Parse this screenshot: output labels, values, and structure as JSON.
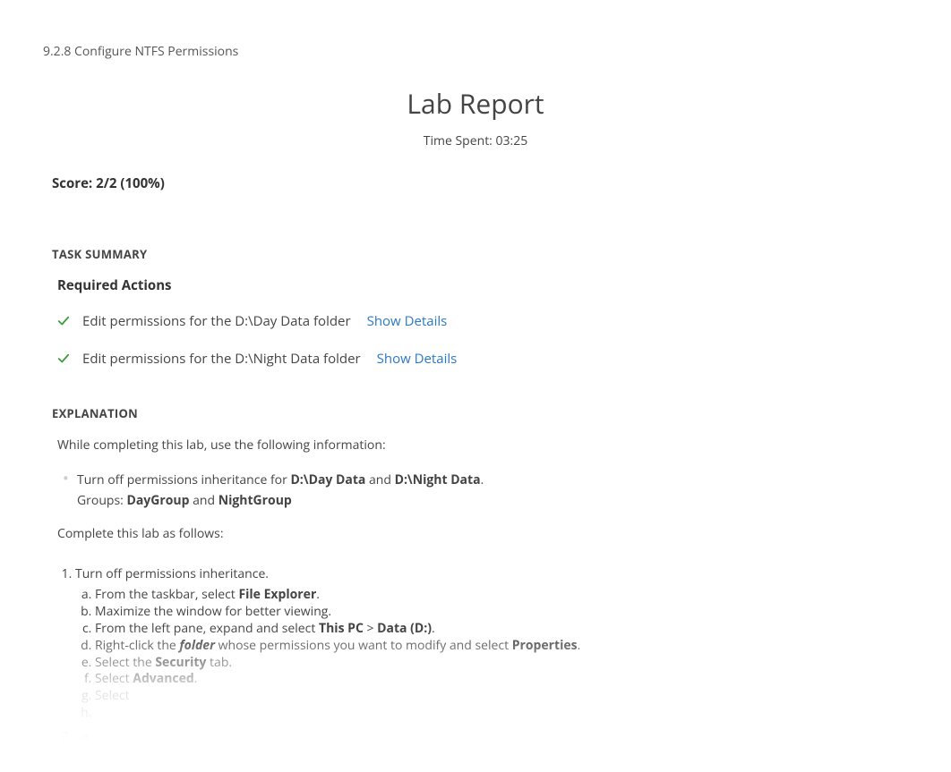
{
  "breadcrumb": "9.2.8 Configure NTFS Permissions",
  "report": {
    "title": "Lab Report",
    "time_label": "Time Spent:",
    "time_value": "03:25",
    "score_label": "Score:",
    "score_value": "2/2 (100%)"
  },
  "task_summary": {
    "heading": "TASK SUMMARY",
    "required_heading": "Required Actions",
    "actions": [
      {
        "text": "Edit permissions for the D:\\Day Data folder",
        "details_label": "Show Details"
      },
      {
        "text": "Edit permissions for the D:\\Night Data folder",
        "details_label": "Show Details"
      }
    ]
  },
  "explanation": {
    "heading": "EXPLANATION",
    "intro": "While completing this lab, use the following information:",
    "bullet": {
      "line1_pre": "Turn off permissions inheritance for ",
      "line1_b1": "D:\\Day Data",
      "line1_mid": " and ",
      "line1_b2": "D:\\Night Data",
      "line1_post": ".",
      "line2_pre": "Groups: ",
      "line2_b1": "DayGroup",
      "line2_mid": " and ",
      "line2_b2": "NightGroup"
    },
    "complete": "Complete this lab as follows:",
    "steps": {
      "s1": "Turn off permissions inheritance.",
      "s1a_pre": "From the taskbar, select ",
      "s1a_b": "File Explorer",
      "s1a_post": ".",
      "s1b": "Maximize the window for better viewing.",
      "s1c_pre": "From the left pane, expand and select ",
      "s1c_b1": "This PC",
      "s1c_mid": " > ",
      "s1c_b2": "Data (D:)",
      "s1c_post": ".",
      "s1d_pre": "Right-click the ",
      "s1d_i": "folder",
      "s1d_mid": " whose permissions you want to modify and select ",
      "s1d_b": "Properties",
      "s1d_post": ".",
      "s1e_pre": "Select the ",
      "s1e_b": "Security",
      "s1e_post": " tab.",
      "s1f_pre": "Select ",
      "s1f_b": "Advanced",
      "s1f_post": ".",
      "s1g": "Select",
      "s1h": " ",
      "s2": " ",
      "s2a": " ",
      "s2b": " "
    }
  }
}
